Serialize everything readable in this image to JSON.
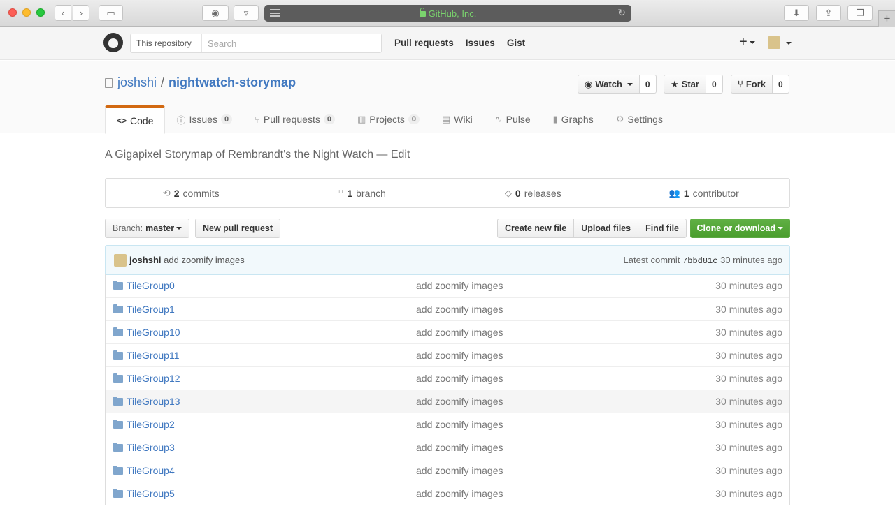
{
  "browser": {
    "address": "GitHub, Inc.",
    "new_tab_label": "+"
  },
  "header": {
    "search_scope": "This repository",
    "search_placeholder": "Search",
    "nav": [
      "Pull requests",
      "Issues",
      "Gist"
    ],
    "plus_label": "+"
  },
  "repo": {
    "owner": "joshshi",
    "separator": "/",
    "name": "nightwatch-storymap",
    "watch_label": "Watch",
    "watch_count": "0",
    "star_label": "Star",
    "star_count": "0",
    "fork_label": "Fork",
    "fork_count": "0"
  },
  "tabs": [
    {
      "label": "Code",
      "icon": "code-icon",
      "glyph": "<>",
      "count": null
    },
    {
      "label": "Issues",
      "icon": "issue-icon",
      "glyph": "ⓘ",
      "count": "0"
    },
    {
      "label": "Pull requests",
      "icon": "pull-request-icon",
      "glyph": "⑂",
      "count": "0"
    },
    {
      "label": "Projects",
      "icon": "project-icon",
      "glyph": "▥",
      "count": "0"
    },
    {
      "label": "Wiki",
      "icon": "book-icon",
      "glyph": "▤",
      "count": null
    },
    {
      "label": "Pulse",
      "icon": "pulse-icon",
      "glyph": "∿",
      "count": null
    },
    {
      "label": "Graphs",
      "icon": "graph-icon",
      "glyph": "▮",
      "count": null
    },
    {
      "label": "Settings",
      "icon": "gear-icon",
      "glyph": "⚙",
      "count": null
    }
  ],
  "description": "A Gigapixel Storymap of Rembrandt's the Night Watch — Edit",
  "summary": {
    "commits_count": "2",
    "commits_label": "commits",
    "branch_count": "1",
    "branch_label": "branch",
    "releases_count": "0",
    "releases_label": "releases",
    "contributor_count": "1",
    "contributor_label": "contributor"
  },
  "filebar": {
    "branch_prefix": "Branch:",
    "branch_name": "master",
    "new_pr": "New pull request",
    "create_file": "Create new file",
    "upload_files": "Upload files",
    "find_file": "Find file",
    "clone": "Clone or download"
  },
  "commit": {
    "author": "joshshi",
    "message": "add zoomify images",
    "latest_label": "Latest commit",
    "sha": "7bbd81c",
    "age": "30 minutes ago"
  },
  "files": [
    {
      "name": "TileGroup0",
      "message": "add zoomify images",
      "age": "30 minutes ago"
    },
    {
      "name": "TileGroup1",
      "message": "add zoomify images",
      "age": "30 minutes ago"
    },
    {
      "name": "TileGroup10",
      "message": "add zoomify images",
      "age": "30 minutes ago"
    },
    {
      "name": "TileGroup11",
      "message": "add zoomify images",
      "age": "30 minutes ago"
    },
    {
      "name": "TileGroup12",
      "message": "add zoomify images",
      "age": "30 minutes ago"
    },
    {
      "name": "TileGroup13",
      "message": "add zoomify images",
      "age": "30 minutes ago"
    },
    {
      "name": "TileGroup2",
      "message": "add zoomify images",
      "age": "30 minutes ago"
    },
    {
      "name": "TileGroup3",
      "message": "add zoomify images",
      "age": "30 minutes ago"
    },
    {
      "name": "TileGroup4",
      "message": "add zoomify images",
      "age": "30 minutes ago"
    },
    {
      "name": "TileGroup5",
      "message": "add zoomify images",
      "age": "30 minutes ago"
    }
  ],
  "colors": {
    "link": "#4078c0",
    "selected_tab_accent": "#d26911",
    "clone_button": "#60b044",
    "address_text": "#7ad36d"
  }
}
